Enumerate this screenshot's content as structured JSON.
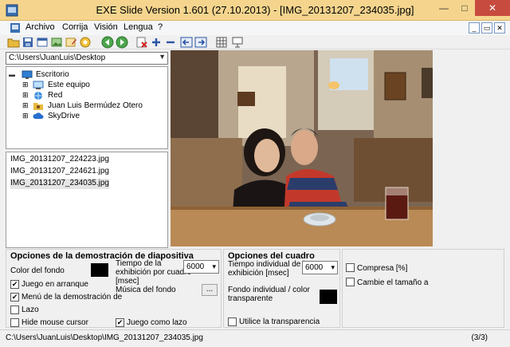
{
  "window": {
    "title": "EXE Slide Version 1.601 (27.10.2013) - [IMG_20131207_234035.jpg]",
    "min": "—",
    "max": "□",
    "close": "✕"
  },
  "menu": {
    "items": [
      "Archivo",
      "Corrija",
      "Visión",
      "Lengua",
      "?"
    ],
    "mdi": [
      "_",
      "▭",
      "✕"
    ]
  },
  "path_combo": "C:\\Users\\JuanLuis\\Desktop",
  "tree": [
    {
      "label": "Escritorio",
      "icon": "desktop-icon"
    },
    {
      "label": "Este equipo",
      "icon": "computer-icon"
    },
    {
      "label": "Red",
      "icon": "network-icon"
    },
    {
      "label": "Juan Luis Bermúdez Otero",
      "icon": "user-folder-icon"
    },
    {
      "label": "SkyDrive",
      "icon": "cloud-icon"
    }
  ],
  "files": [
    "IMG_20131207_224223.jpg",
    "IMG_20131207_224621.jpg",
    "IMG_20131207_234035.jpg"
  ],
  "options_demo": {
    "title": "Opciones de la demostración de diapositiva",
    "bg_color_label": "Color del fondo",
    "game_start": {
      "label": "Juego en arranque",
      "checked": true
    },
    "demo_menu": {
      "label": "Menú de la demostración de",
      "checked": true
    },
    "loop": {
      "label": "Lazo",
      "checked": false
    },
    "hide_cursor": {
      "label": "Hide mouse cursor",
      "checked": false
    },
    "time_label_1": "Tiempo de la",
    "time_label_2": "exhibición por cuadro",
    "time_label_3": "[msec]",
    "time_value": "6000",
    "music_label": "Música del fondo",
    "music_button": "...",
    "game_loop": {
      "label": "Juego como lazo",
      "checked": true
    }
  },
  "options_frame": {
    "title": "Opciones del cuadro",
    "time_label_1": "Tiempo individual de la",
    "time_label_2": "exhibición [msec]",
    "time_value": "6000",
    "bg_label_1": "Fondo individual / color",
    "bg_label_2": "transparente",
    "transparency": {
      "label": "Utilice la transparencia",
      "checked": false
    }
  },
  "options_extra": {
    "compress": {
      "label": "Compresa [%]",
      "checked": false
    },
    "resize": {
      "label": "Cambie el tamaño a",
      "checked": false
    }
  },
  "status": {
    "path": "C:\\Users\\JuanLuis\\Desktop\\IMG_20131207_234035.jpg",
    "count": "(3/3)"
  },
  "colors": {
    "titlebar": "#f5d58e",
    "close": "#c74b3f"
  }
}
